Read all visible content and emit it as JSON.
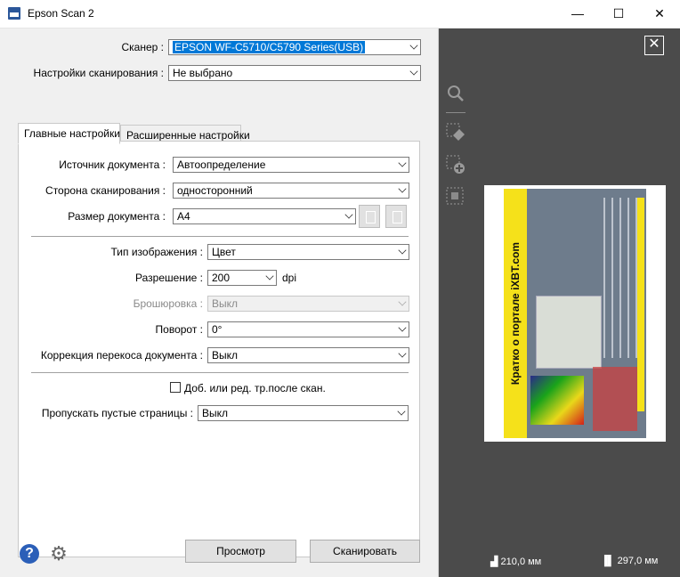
{
  "window": {
    "title": "Epson Scan 2",
    "minimize": "—",
    "maximize": "☐",
    "close": "✕"
  },
  "scanner": {
    "label": "Сканер :",
    "value": "EPSON WF-C5710/C5790 Series(USB)"
  },
  "scan_settings": {
    "label": "Настройки сканирования :",
    "value": "Не выбрано"
  },
  "tabs": [
    {
      "label": "Главные настройки"
    },
    {
      "label": "Расширенные настройки"
    }
  ],
  "main": {
    "source": {
      "label": "Источник документа :",
      "value": "Автоопределение"
    },
    "side": {
      "label": "Сторона сканирования :",
      "value": "односторонний"
    },
    "size": {
      "label": "Размер документа :",
      "value": "A4"
    },
    "image_type": {
      "label": "Тип изображения :",
      "value": "Цвет"
    },
    "resolution": {
      "label": "Разрешение :",
      "value": "200",
      "unit": "dpi"
    },
    "binding": {
      "label": "Брошюровка :",
      "value": "Выкл"
    },
    "rotation": {
      "label": "Поворот :",
      "value": "0°"
    },
    "skew": {
      "label": "Коррекция перекоса документа :",
      "value": "Выкл"
    },
    "add_edit": {
      "label": "Доб. или ред. тр.после скан."
    },
    "skip_blank": {
      "label": "Пропускать пустые страницы :",
      "value": "Выкл"
    }
  },
  "buttons": {
    "preview": "Просмотр",
    "scan": "Сканировать"
  },
  "preview": {
    "doc_heading": "Кратко о портале iXBT.com",
    "width_readout": "210,0 мм",
    "height_readout": "297,0 мм"
  },
  "icons": [
    "help-icon",
    "gear-icon",
    "zoom-icon",
    "eraser-icon",
    "add-area-icon",
    "select-area-icon",
    "close-icon"
  ]
}
